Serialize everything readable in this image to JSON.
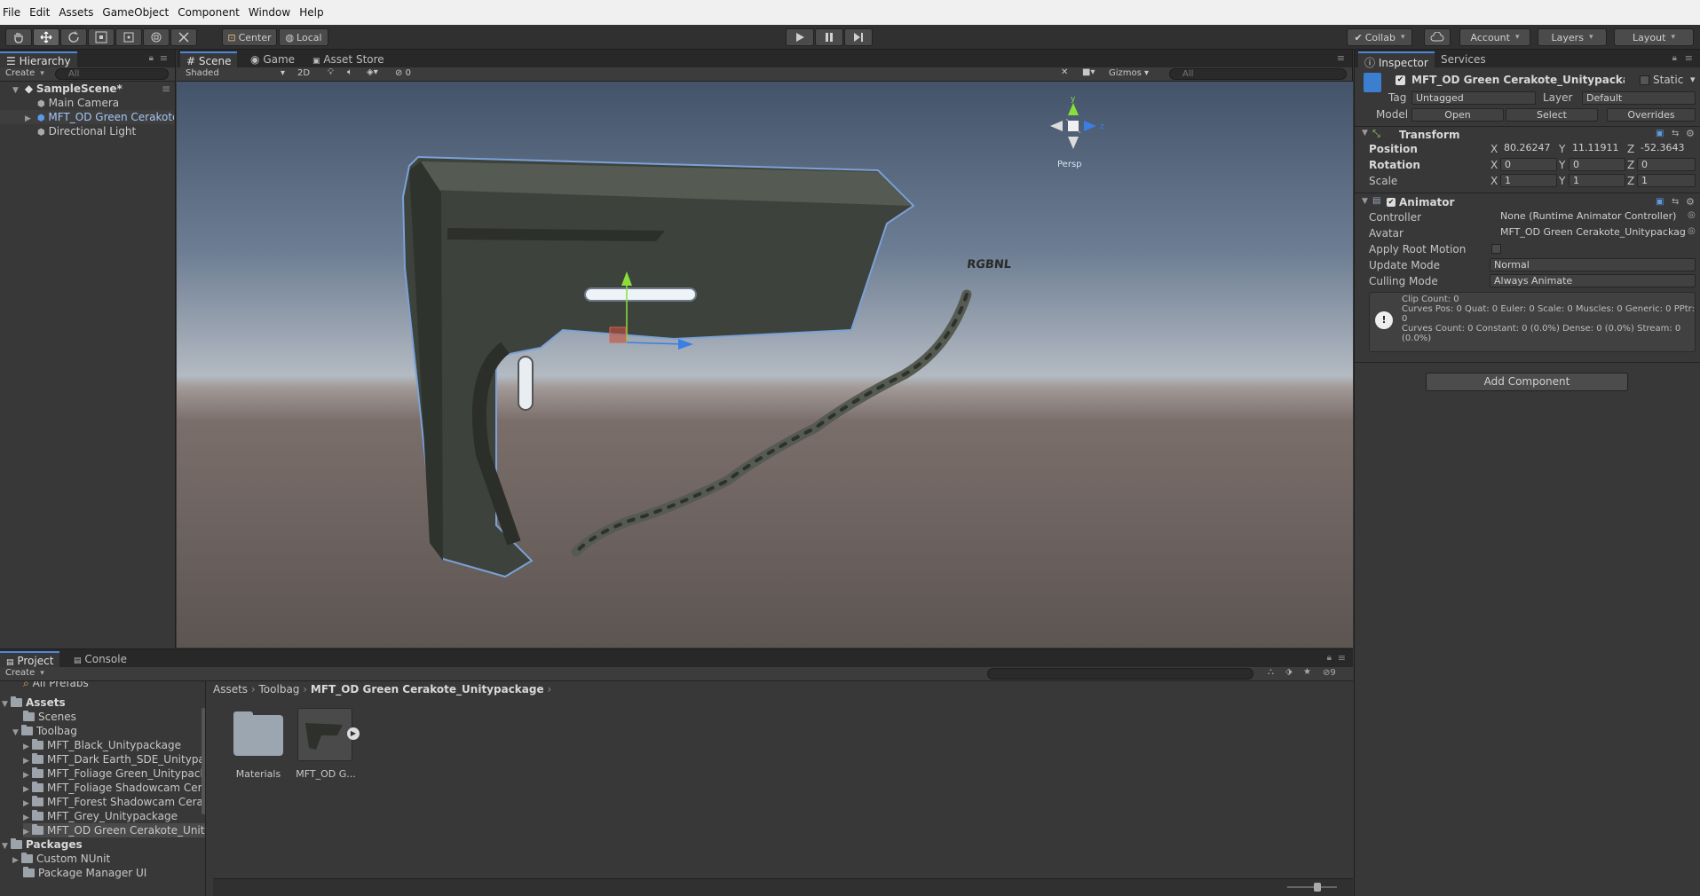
{
  "menu": [
    "File",
    "Edit",
    "Assets",
    "GameObject",
    "Component",
    "Window",
    "Help"
  ],
  "toolbar": {
    "pivot": "Center",
    "space": "Local",
    "collab": "Collab",
    "account": "Account",
    "layers": "Layers",
    "layout": "Layout"
  },
  "hierarchy": {
    "tab": "Hierarchy",
    "create": "Create",
    "search_placeholder": "All",
    "scene": "SampleScene*",
    "items": [
      "Main Camera",
      "MFT_OD Green Cerakote_Unitypackage",
      "Directional Light"
    ]
  },
  "scene": {
    "tabs": [
      "Scene",
      "Game",
      "Asset Store"
    ],
    "shading": "Shaded",
    "mode2d": "2D",
    "fx_count": "0",
    "gizmos": "Gizmos",
    "search_placeholder": "All",
    "persp": "Persp",
    "axes": {
      "x": "x",
      "y": "y",
      "z": "z"
    },
    "model_text": "RGBNL"
  },
  "inspector": {
    "tabs": [
      "Inspector",
      "Services"
    ],
    "object_name": "MFT_OD Green Cerakote_Unitypackage",
    "static": "Static",
    "tag_label": "Tag",
    "tag_value": "Untagged",
    "layer_label": "Layer",
    "layer_value": "Default",
    "model_label": "Model",
    "model_buttons": [
      "Open",
      "Select",
      "Overrides"
    ],
    "transform": {
      "title": "Transform",
      "position_label": "Position",
      "position": {
        "x": "80.26247",
        "y": "11.11911",
        "z": "-52.3643"
      },
      "rotation_label": "Rotation",
      "rotation": {
        "x": "0",
        "y": "0",
        "z": "0"
      },
      "scale_label": "Scale",
      "scale": {
        "x": "1",
        "y": "1",
        "z": "1"
      }
    },
    "animator": {
      "title": "Animator",
      "controller_label": "Controller",
      "controller_value": "None (Runtime Animator Controller)",
      "avatar_label": "Avatar",
      "avatar_value": "MFT_OD Green Cerakote_UnitypackageAvatar",
      "apply_root_label": "Apply Root Motion",
      "update_label": "Update Mode",
      "update_value": "Normal",
      "culling_label": "Culling Mode",
      "culling_value": "Always Animate",
      "info": [
        "Clip Count: 0",
        "Curves Pos: 0 Quat: 0 Euler: 0 Scale: 0 Muscles: 0 Generic: 0 PPtr: 0",
        "Curves Count: 0 Constant: 0 (0.0%) Dense: 0 (0.0%) Stream: 0 (0.0%)"
      ]
    },
    "add_component": "Add Component"
  },
  "project": {
    "tabs": [
      "Project",
      "Console"
    ],
    "create": "Create",
    "hidden_count": "9",
    "all_prefabs": "All Prefabs",
    "assets": "Assets",
    "scenes": "Scenes",
    "toolbag": "Toolbag",
    "toolbag_children": [
      "MFT_Black_Unitypackage",
      "MFT_Dark Earth_SDE_Unitypackage",
      "MFT_Foliage Green_Unitypackage",
      "MFT_Foliage Shadowcam Cerakote",
      "MFT_Forest Shadowcam Cerakote",
      "MFT_Grey_Unitypackage",
      "MFT_OD Green Cerakote_Unitypackage"
    ],
    "packages": "Packages",
    "package_children": [
      "Custom NUnit",
      "Package Manager UI"
    ],
    "breadcrumb": [
      "Assets",
      "Toolbag",
      "MFT_OD Green Cerakote_Unitypackage"
    ],
    "files": [
      "Materials",
      "MFT_OD G..."
    ]
  },
  "colors": {
    "selection": "#3e5f96",
    "tab_accent": "#4f87d9",
    "model_green": "#3f433b"
  }
}
